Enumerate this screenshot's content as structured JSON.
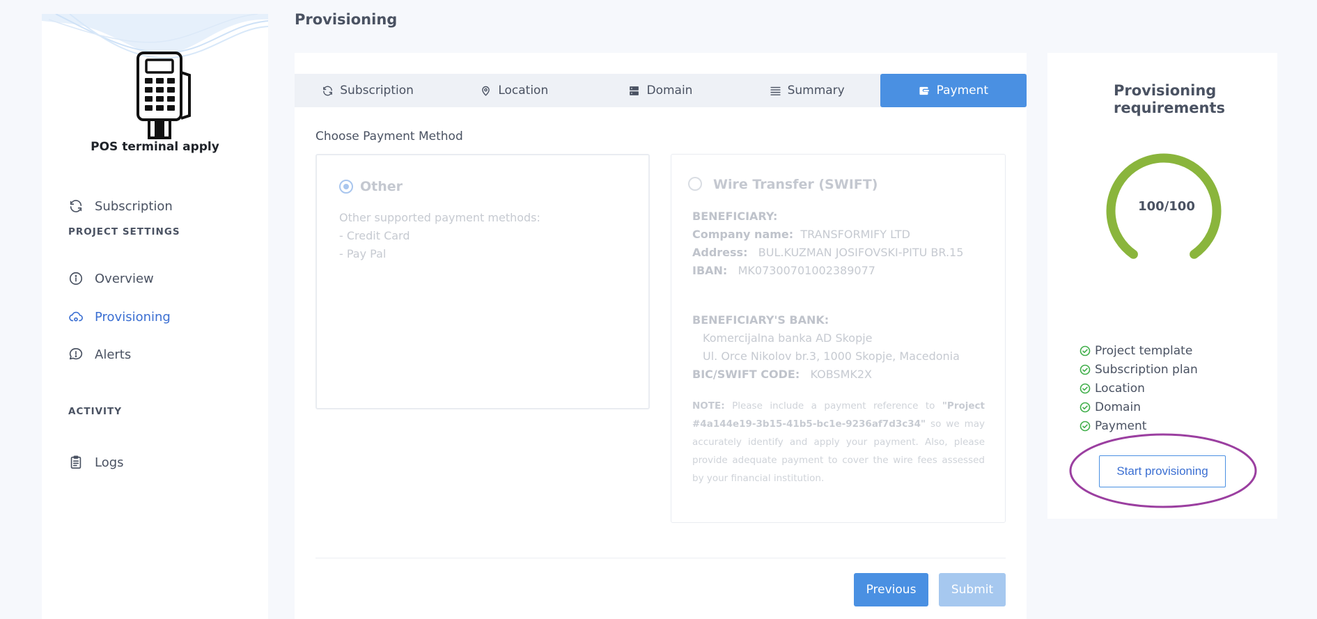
{
  "sidebar": {
    "app_name": "POS terminal apply",
    "items": [
      {
        "label": "Subscription",
        "icon": "refresh-icon"
      },
      {
        "label": "Overview",
        "icon": "info-icon"
      },
      {
        "label": "Provisioning",
        "icon": "cloud-icon"
      },
      {
        "label": "Alerts",
        "icon": "chat-alert-icon"
      },
      {
        "label": "Logs",
        "icon": "clipboard-icon"
      }
    ],
    "sections": {
      "project_settings": "PROJECT SETTINGS",
      "activity": "ACTIVITY"
    },
    "active_item": "Provisioning"
  },
  "page": {
    "title": "Provisioning"
  },
  "tabs": [
    {
      "label": "Subscription",
      "icon": "refresh-icon"
    },
    {
      "label": "Location",
      "icon": "map-pin-icon"
    },
    {
      "label": "Domain",
      "icon": "server-icon"
    },
    {
      "label": "Summary",
      "icon": "list-icon"
    },
    {
      "label": "Payment",
      "icon": "wallet-icon"
    }
  ],
  "active_tab": "Payment",
  "payment": {
    "section_label": "Choose Payment Method",
    "other": {
      "title": "Other",
      "desc": "Other supported payment methods:",
      "methods": [
        "- Credit Card",
        "- Pay Pal"
      ]
    },
    "wire": {
      "title": "Wire Transfer (SWIFT)",
      "beneficiary_label": "BENEFICIARY:",
      "company_label": "Company name:",
      "company_value": "TRANSFORMIFY LTD",
      "address_label": "Address:",
      "address_value": "BUL.KUZMAN JOSIFOVSKI-PITU BR.15",
      "iban_label": "IBAN:",
      "iban_value": "MK07300701002389077",
      "bank_label": "BENEFICIARY'S BANK:",
      "bank_name": "Komercijalna banka AD Skopje",
      "bank_address": "Ul. Orce Nikolov br.3, 1000 Skopje, Macedonia",
      "swift_label": "BIC/SWIFT CODE:",
      "swift_value": "KOBSMK2X",
      "note_label": "NOTE:",
      "note_text_1": "Please include a payment reference to",
      "note_ref": "\"Project #4a144e19-3b15-41b5-bc1e-9236af7d3c34\"",
      "note_text_2": "so we may accurately identify and apply your payment. Also, please provide adequate payment to cover the wire fees assessed by your financial institution."
    },
    "buttons": {
      "previous": "Previous",
      "submit": "Submit"
    }
  },
  "requirements": {
    "title": "Provisioning requirements",
    "score_text": "100/100",
    "score_fraction": 1.0,
    "items": [
      "Project template",
      "Subscription plan",
      "Location",
      "Domain",
      "Payment"
    ],
    "start_button": "Start provisioning"
  },
  "colors": {
    "accent": "#4a90e2",
    "gauge": "#8ab53c",
    "check": "#3fae49",
    "highlight": "#9b3fa0"
  }
}
